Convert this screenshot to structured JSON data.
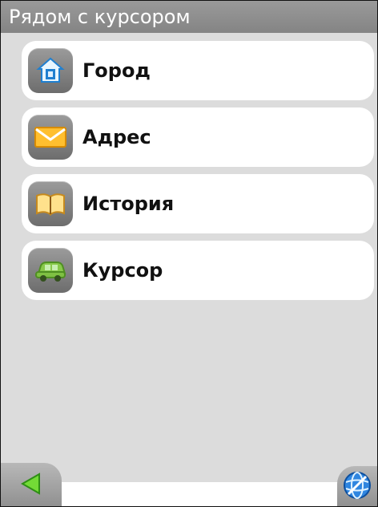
{
  "header": {
    "title": "Рядом с курсором"
  },
  "menu": {
    "items": [
      {
        "label": "Город",
        "icon": "house-icon"
      },
      {
        "label": "Адрес",
        "icon": "envelope-icon"
      },
      {
        "label": "История",
        "icon": "book-icon"
      },
      {
        "label": "Курсор",
        "icon": "car-icon"
      }
    ]
  },
  "footer": {
    "back_icon": "back-arrow-icon",
    "globe_icon": "globe-icon"
  },
  "colors": {
    "title_bar": "#8e8e8e",
    "background": "#dcdcdc",
    "item_background": "#ffffff",
    "back_arrow": "#6fd63a"
  }
}
